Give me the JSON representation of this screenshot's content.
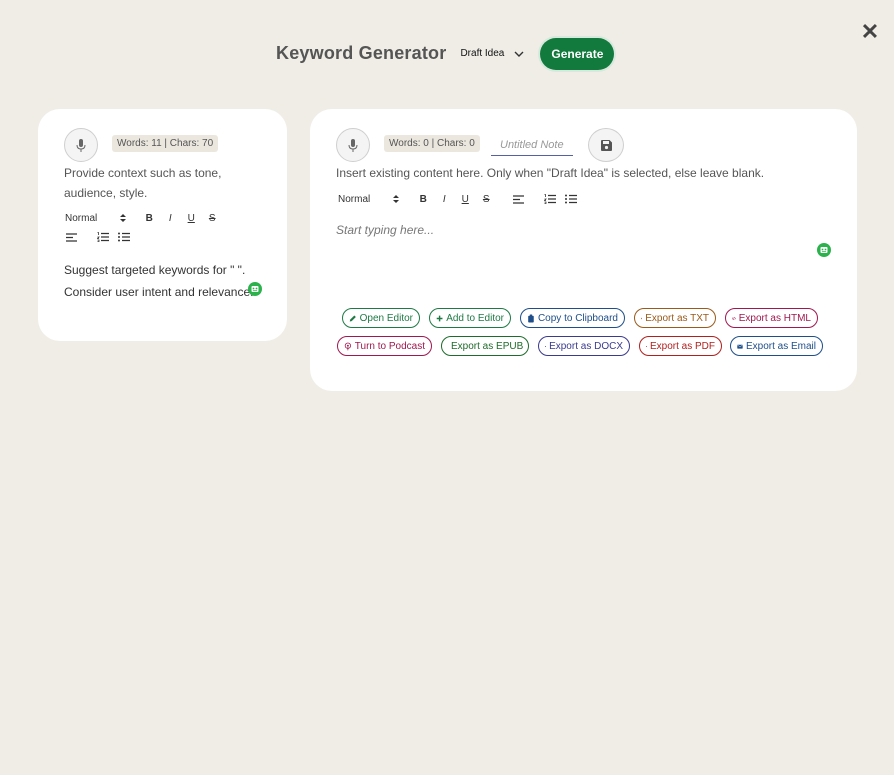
{
  "header": {
    "title": "Keyword Generator",
    "mode_value": "Draft Idea",
    "generate_label": "Generate"
  },
  "left_card": {
    "badge": "Words: 11 | Chars: 70",
    "hint": "Provide context such as tone, audience, style.",
    "format_value": "Normal",
    "prompt_line1": "Suggest targeted keywords for \" \".",
    "prompt_line2": "Consider user intent and relevance."
  },
  "right_card": {
    "badge": "Words: 0 | Chars: 0",
    "note_placeholder": "Untitled Note",
    "hint": "Insert existing content here. Only when \"Draft Idea\" is selected, else leave blank.",
    "format_value": "Normal",
    "editor_placeholder": "Start typing here..."
  },
  "actions": {
    "open_editor": "Open Editor",
    "add_to_editor": "Add to Editor",
    "copy_clipboard": "Copy to Clipboard",
    "export_txt": "Export as TXT",
    "export_html": "Export as HTML",
    "podcast": "Turn to Podcast",
    "export_epub": "Export as EPUB",
    "export_docx": "Export as DOCX",
    "export_pdf": "Export as PDF",
    "export_email": "Export as Email"
  },
  "colors": {
    "accent_green": "#137a3e",
    "background": "#efede6",
    "robot_green": "#2bb24c"
  }
}
